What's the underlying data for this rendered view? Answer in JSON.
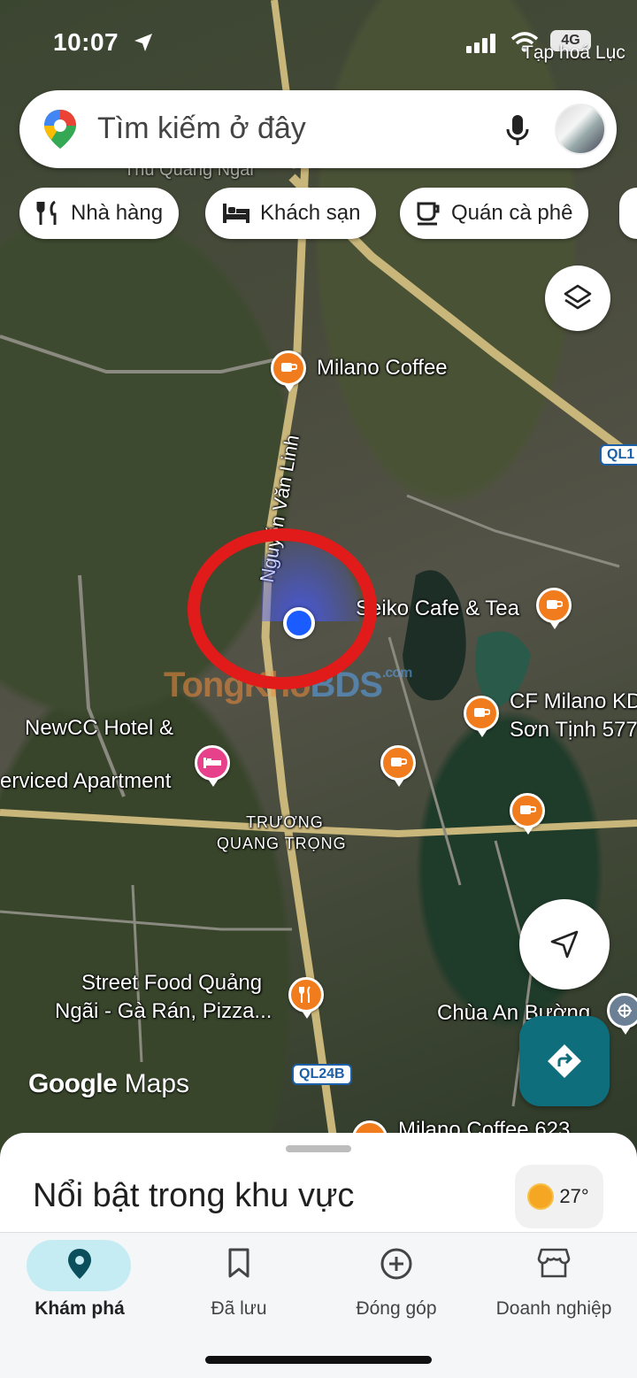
{
  "status_bar": {
    "time": "10:07",
    "network": "4G"
  },
  "map": {
    "top_place": "Tạp hoá Lục",
    "search": {
      "placeholder": "Tìm kiếm ở đây"
    },
    "chips": [
      {
        "label": "Nhà hàng",
        "icon": "restaurant-icon"
      },
      {
        "label": "Khách sạn",
        "icon": "hotel-icon"
      },
      {
        "label": "Quán cà phê",
        "icon": "coffee-icon"
      }
    ],
    "labels": {
      "milano_coffee": "Milano Coffee",
      "street_nguyen_van_linh": "Nguyễn Văn Linh",
      "seiko": "Seiko Cafe & Tea",
      "cf_milano_1": "CF Milano KD",
      "cf_milano_2": "Sơn Tịnh 577",
      "newcc_1": "NewCC Hotel &",
      "newcc_2": "erviced Apartment",
      "truong_1": "TRƯƠNG",
      "truong_2": "QUANG TRỌNG",
      "street_food_1": "Street Food Quảng",
      "street_food_2": "Ngãi - Gà Rán, Pizza...",
      "chua": "Chùa An Bường",
      "milano_623": "Milano Coffee 623",
      "top_faint": "Thu Quang Ngai"
    },
    "shields": {
      "ql1": "QL1",
      "ql24b": "QL24B"
    },
    "watermark": {
      "part1": "TongKho",
      "part2": "BDS",
      "suffix": ".com"
    },
    "branding": {
      "google": "Google",
      "maps": "Maps"
    }
  },
  "sheet": {
    "title": "Nổi bật trong khu vực",
    "weather": {
      "temp": "27°"
    }
  },
  "bottom_nav": [
    {
      "label": "Khám phá",
      "icon": "explore-pin-icon",
      "active": true
    },
    {
      "label": "Đã lưu",
      "icon": "bookmark-icon",
      "active": false
    },
    {
      "label": "Đóng góp",
      "icon": "add-circle-icon",
      "active": false
    },
    {
      "label": "Doanh nghiệp",
      "icon": "storefront-icon",
      "active": false
    }
  ],
  "colors": {
    "accent_teal": "#0f6e7c",
    "poi_orange": "#f07c1e",
    "hotel_pink": "#e8418c",
    "highlight_red": "#e11a1a",
    "location_blue": "#1a5cff"
  }
}
